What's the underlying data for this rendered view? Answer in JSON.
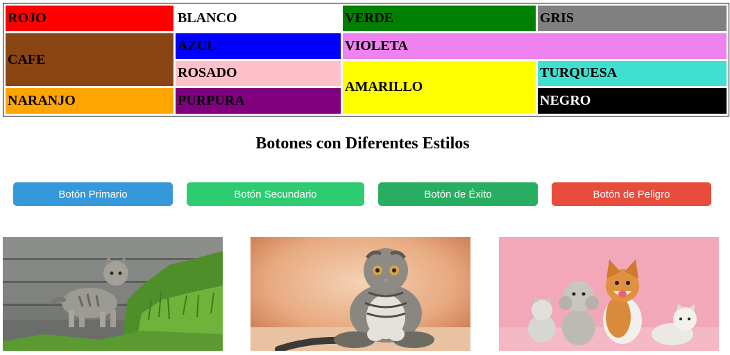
{
  "color_table": {
    "rojo": {
      "label": "ROJO",
      "bg": "#ff0000",
      "fg": "#000000"
    },
    "blanco": {
      "label": "BLANCO",
      "bg": "#ffffff",
      "fg": "#000000"
    },
    "verde": {
      "label": "VERDE",
      "bg": "#008000",
      "fg": "#000000"
    },
    "gris": {
      "label": "GRIS",
      "bg": "#808080",
      "fg": "#000000"
    },
    "cafe": {
      "label": "CAFE",
      "bg": "#8b4513",
      "fg": "#000000"
    },
    "azul": {
      "label": "AZUL",
      "bg": "#0000ff",
      "fg": "#000000"
    },
    "violeta": {
      "label": "VIOLETA",
      "bg": "#ee82ee",
      "fg": "#000000"
    },
    "rosado": {
      "label": "ROSADO",
      "bg": "#ffc0cb",
      "fg": "#000000"
    },
    "amarillo": {
      "label": "AMARILLO",
      "bg": "#ffff00",
      "fg": "#000000"
    },
    "turquesa": {
      "label": "TURQUESA",
      "bg": "#40e0d0",
      "fg": "#000000"
    },
    "naranjo": {
      "label": "NARANJO",
      "bg": "#ffa500",
      "fg": "#000000"
    },
    "purpura": {
      "label": "PURPURA",
      "bg": "#800080",
      "fg": "#000000"
    },
    "negro": {
      "label": "NEGRO",
      "bg": "#000000",
      "fg": "#ffffff"
    }
  },
  "buttons_section": {
    "heading": "Botones con Diferentes Estilos",
    "buttons": [
      {
        "label": "Botón Primario",
        "color": "#3498db"
      },
      {
        "label": "Botón Secundario",
        "color": "#2ecc71"
      },
      {
        "label": "Botón de Éxito",
        "color": "#27ae60"
      },
      {
        "label": "Botón de Peligro",
        "color": "#e74c3c"
      }
    ]
  },
  "images": [
    {
      "subject": "tabby-kitten-on-steps-photo"
    },
    {
      "subject": "scottish-fold-cat-sitting-photo"
    },
    {
      "subject": "cats-and-dogs-on-pink-photo"
    }
  ]
}
